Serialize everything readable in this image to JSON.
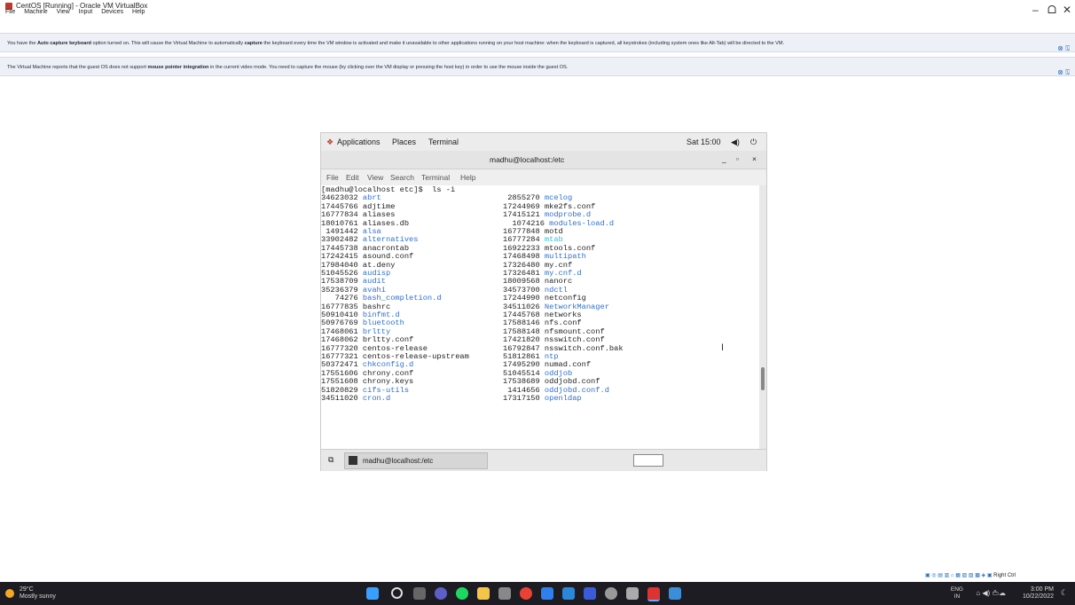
{
  "window": {
    "title": "CentOS [Running] - Oracle VM VirtualBox",
    "menu": [
      "File",
      "Machine",
      "View",
      "Input",
      "Devices",
      "Help"
    ],
    "controls": [
      "–",
      "ᗝ",
      "✕"
    ]
  },
  "notices": [
    {
      "pre": "You have the ",
      "b1": "Auto capture keyboard",
      "mid": " option turned on. This will cause the Virtual Machine to automatically ",
      "b2": "capture",
      "post": " the keyboard every time the VM window is activated and make it unavailable to other applications running on your host machine: when the keyboard is captured, all keystrokes (including system ones like Alt-Tab) will be directed to the VM."
    },
    {
      "pre": "The Virtual Machine reports that the guest OS does not support ",
      "b1": "mouse pointer integration",
      "mid": " in the current video mode. You need to capture the mouse (by clicking over the VM display or pressing the host key) in order to use the mouse inside the guest OS.",
      "b2": "",
      "post": ""
    }
  ],
  "gnome": {
    "applications": "Applications",
    "places": "Places",
    "terminal": "Terminal",
    "clock": "Sat 15:00"
  },
  "terminal": {
    "title": "madhu@localhost:/etc",
    "menu": [
      "File",
      "Edit",
      "View",
      "Search",
      "Terminal",
      "Help"
    ],
    "prompt": "[madhu@localhost etc]$  ls -i",
    "taskbar_item": "madhu@localhost:/etc"
  },
  "listing": {
    "col1": [
      {
        "t": "34623032 ",
        "n": "abrt",
        "c": "blue"
      },
      {
        "t": "17445766 ",
        "n": "adjtime",
        "c": ""
      },
      {
        "t": "16777834 ",
        "n": "aliases",
        "c": ""
      },
      {
        "t": "18010761 ",
        "n": "aliases.db",
        "c": ""
      },
      {
        "t": " 1491442 ",
        "n": "alsa",
        "c": "blue"
      },
      {
        "t": "33902482 ",
        "n": "alternatives",
        "c": "blue"
      },
      {
        "t": "17445738 ",
        "n": "anacrontab",
        "c": ""
      },
      {
        "t": "17242415 ",
        "n": "asound.conf",
        "c": ""
      },
      {
        "t": "17984040 ",
        "n": "at.deny",
        "c": ""
      },
      {
        "t": "51045526 ",
        "n": "audisp",
        "c": "blue"
      },
      {
        "t": "17538709 ",
        "n": "audit",
        "c": "blue"
      },
      {
        "t": "35236379 ",
        "n": "avahi",
        "c": "blue"
      },
      {
        "t": "   74276 ",
        "n": "bash_completion.d",
        "c": "blue"
      },
      {
        "t": "16777835 ",
        "n": "bashrc",
        "c": ""
      },
      {
        "t": "50910410 ",
        "n": "binfmt.d",
        "c": "blue"
      },
      {
        "t": "50976769 ",
        "n": "bluetooth",
        "c": "blue"
      },
      {
        "t": "17468061 ",
        "n": "brltty",
        "c": "blue"
      },
      {
        "t": "17468062 ",
        "n": "brltty.conf",
        "c": ""
      },
      {
        "t": "16777320 ",
        "n": "centos-release",
        "c": ""
      },
      {
        "t": "16777321 ",
        "n": "centos-release-upstream",
        "c": ""
      },
      {
        "t": "50372471 ",
        "n": "chkconfig.d",
        "c": "blue"
      },
      {
        "t": "17551606 ",
        "n": "chrony.conf",
        "c": ""
      },
      {
        "t": "17551608 ",
        "n": "chrony.keys",
        "c": ""
      },
      {
        "t": "51820829 ",
        "n": "cifs-utils",
        "c": "blue"
      },
      {
        "t": "34511020 ",
        "n": "cron.d",
        "c": "blue"
      }
    ],
    "col2": [
      {
        "t": " 2855270 ",
        "n": "mcelog",
        "c": "blue"
      },
      {
        "t": "17244969 ",
        "n": "mke2fs.conf",
        "c": ""
      },
      {
        "t": "17415121 ",
        "n": "modprobe.d",
        "c": "blue"
      },
      {
        "t": "  1074216 ",
        "n": "modules-load.d",
        "c": "blue"
      },
      {
        "t": "16777848 ",
        "n": "motd",
        "c": ""
      },
      {
        "t": "16777284 ",
        "n": "mtab",
        "c": "cyan"
      },
      {
        "t": "16922233 ",
        "n": "mtools.conf",
        "c": ""
      },
      {
        "t": "17468498 ",
        "n": "multipath",
        "c": "blue"
      },
      {
        "t": "17326480 ",
        "n": "my.cnf",
        "c": ""
      },
      {
        "t": "17326481 ",
        "n": "my.cnf.d",
        "c": "blue"
      },
      {
        "t": "18009568 ",
        "n": "nanorc",
        "c": ""
      },
      {
        "t": "34573700 ",
        "n": "ndctl",
        "c": "blue"
      },
      {
        "t": "17244990 ",
        "n": "netconfig",
        "c": ""
      },
      {
        "t": "34511026 ",
        "n": "NetworkManager",
        "c": "blue"
      },
      {
        "t": "17445768 ",
        "n": "networks",
        "c": ""
      },
      {
        "t": "17588146 ",
        "n": "nfs.conf",
        "c": ""
      },
      {
        "t": "17588148 ",
        "n": "nfsmount.conf",
        "c": ""
      },
      {
        "t": "17421820 ",
        "n": "nsswitch.conf",
        "c": ""
      },
      {
        "t": "16792847 ",
        "n": "nsswitch.conf.bak",
        "c": ""
      },
      {
        "t": "51812861 ",
        "n": "ntp",
        "c": "blue"
      },
      {
        "t": "17495290 ",
        "n": "numad.conf",
        "c": ""
      },
      {
        "t": "51045514 ",
        "n": "oddjob",
        "c": "blue"
      },
      {
        "t": "17538689 ",
        "n": "oddjobd.conf",
        "c": ""
      },
      {
        "t": " 1414656 ",
        "n": "oddjobd.conf.d",
        "c": "blue"
      },
      {
        "t": "17317150 ",
        "n": "openldap",
        "c": "blue"
      }
    ]
  },
  "taskbar": {
    "weather_temp": "29°C",
    "weather_desc": "Mostly sunny",
    "lang1": "ENG",
    "lang2": "IN",
    "time": "3:00 PM",
    "date": "10/22/2022"
  },
  "vbox_status": {
    "host_key": "Right Ctrl"
  }
}
